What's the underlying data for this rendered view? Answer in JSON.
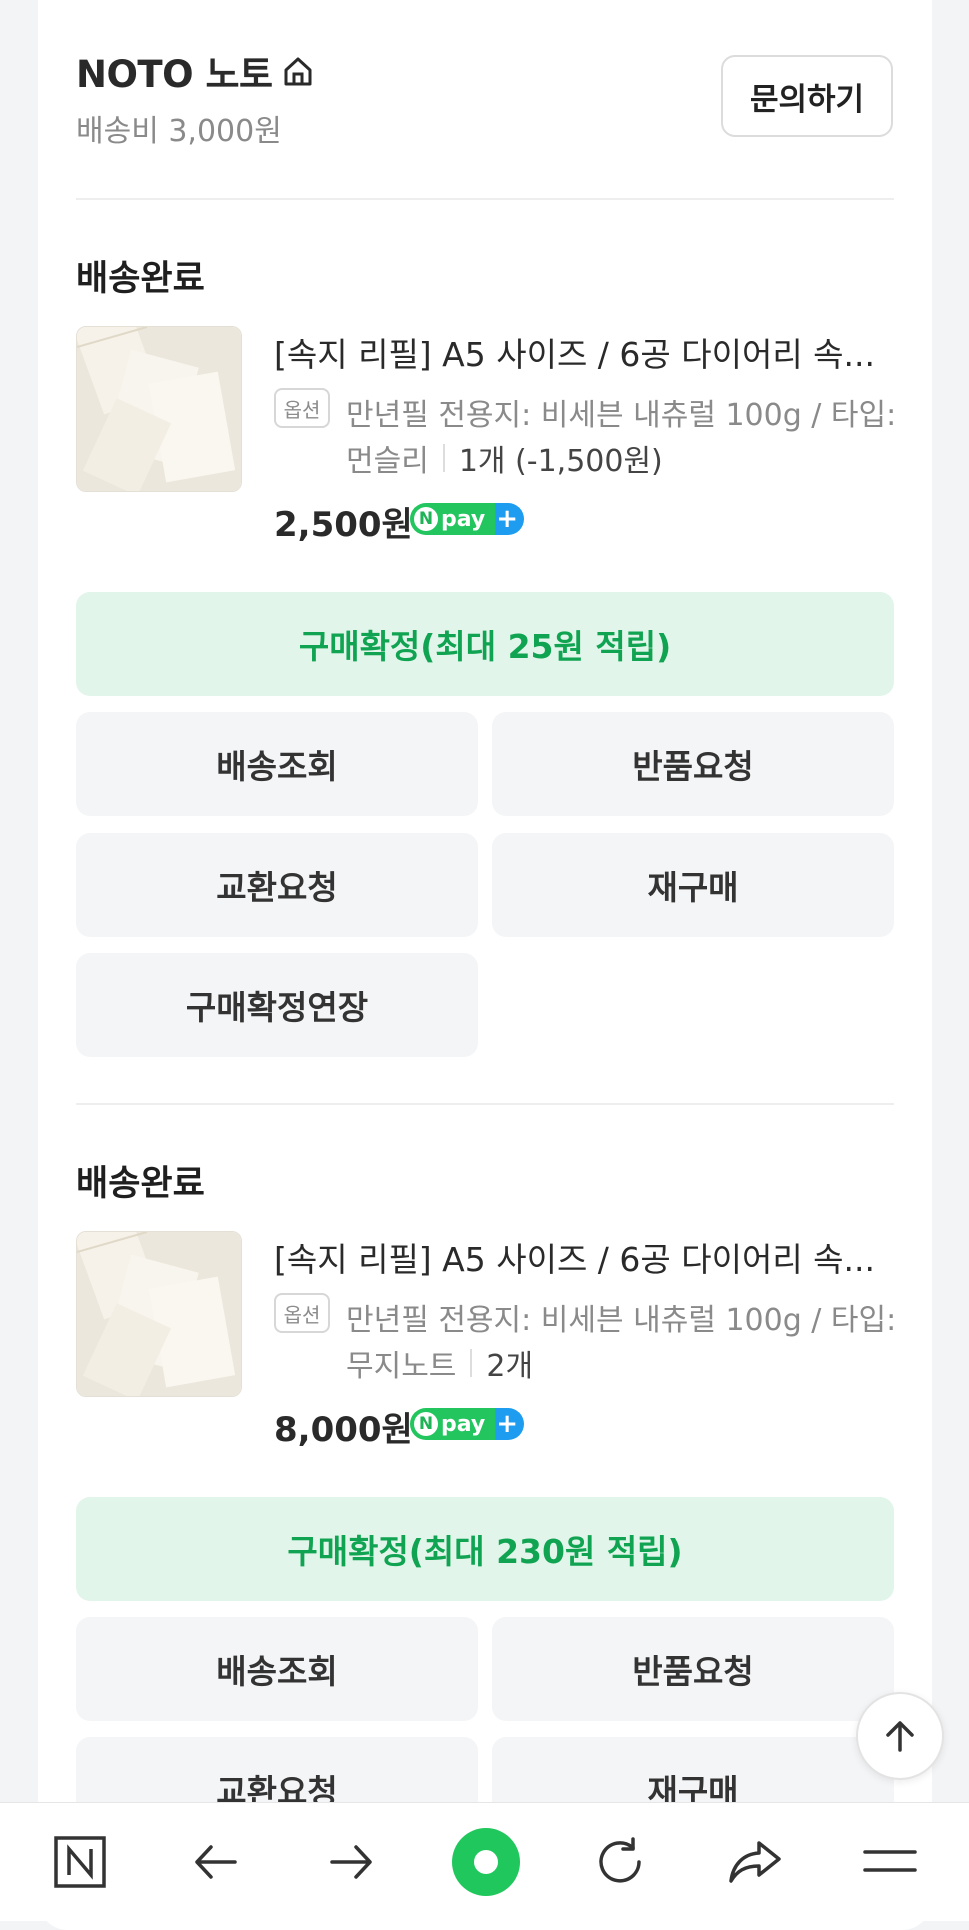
{
  "store": {
    "name": "NOTO 노토",
    "shipping_fee": "배송비 3,000원",
    "inquiry_label": "문의하기"
  },
  "orders": [
    {
      "status": "배송완료",
      "title": "[속지 리필] A5 사이즈 / 6공 다이어리 속...",
      "option_badge": "옵션",
      "option_line1": "만년필 전용지: 비세븐 내츄럴 100g / 타입:",
      "option_line2": "먼슬리",
      "quantity": "1개 (-1,500원)",
      "price": "2,500원",
      "npay_label": "pay",
      "confirm_label": "구매확정(최대 25원 적립)",
      "buttons": [
        "배송조회",
        "반품요청",
        "교환요청",
        "재구매",
        "구매확정연장"
      ]
    },
    {
      "status": "배송완료",
      "title": "[속지 리필] A5 사이즈 / 6공 다이어리 속...",
      "option_badge": "옵션",
      "option_line1": "만년필 전용지: 비세븐 내츄럴 100g / 타입:",
      "option_line2": "무지노트",
      "quantity": "2개",
      "price": "8,000원",
      "npay_label": "pay",
      "confirm_label": "구매확정(최대 230원 적립)",
      "buttons": [
        "배송조회",
        "반품요청",
        "교환요청",
        "재구매"
      ]
    }
  ],
  "colors": {
    "accent_green": "#10a452",
    "confirm_bg": "#e2f5ea",
    "button_bg": "#f4f5f7",
    "npay_blue": "#1e9cf0"
  },
  "navbar": {
    "icons": [
      "naver-n-icon",
      "back-arrow-icon",
      "forward-arrow-icon",
      "green-dot-icon",
      "refresh-icon",
      "share-icon",
      "menu-icon"
    ]
  }
}
